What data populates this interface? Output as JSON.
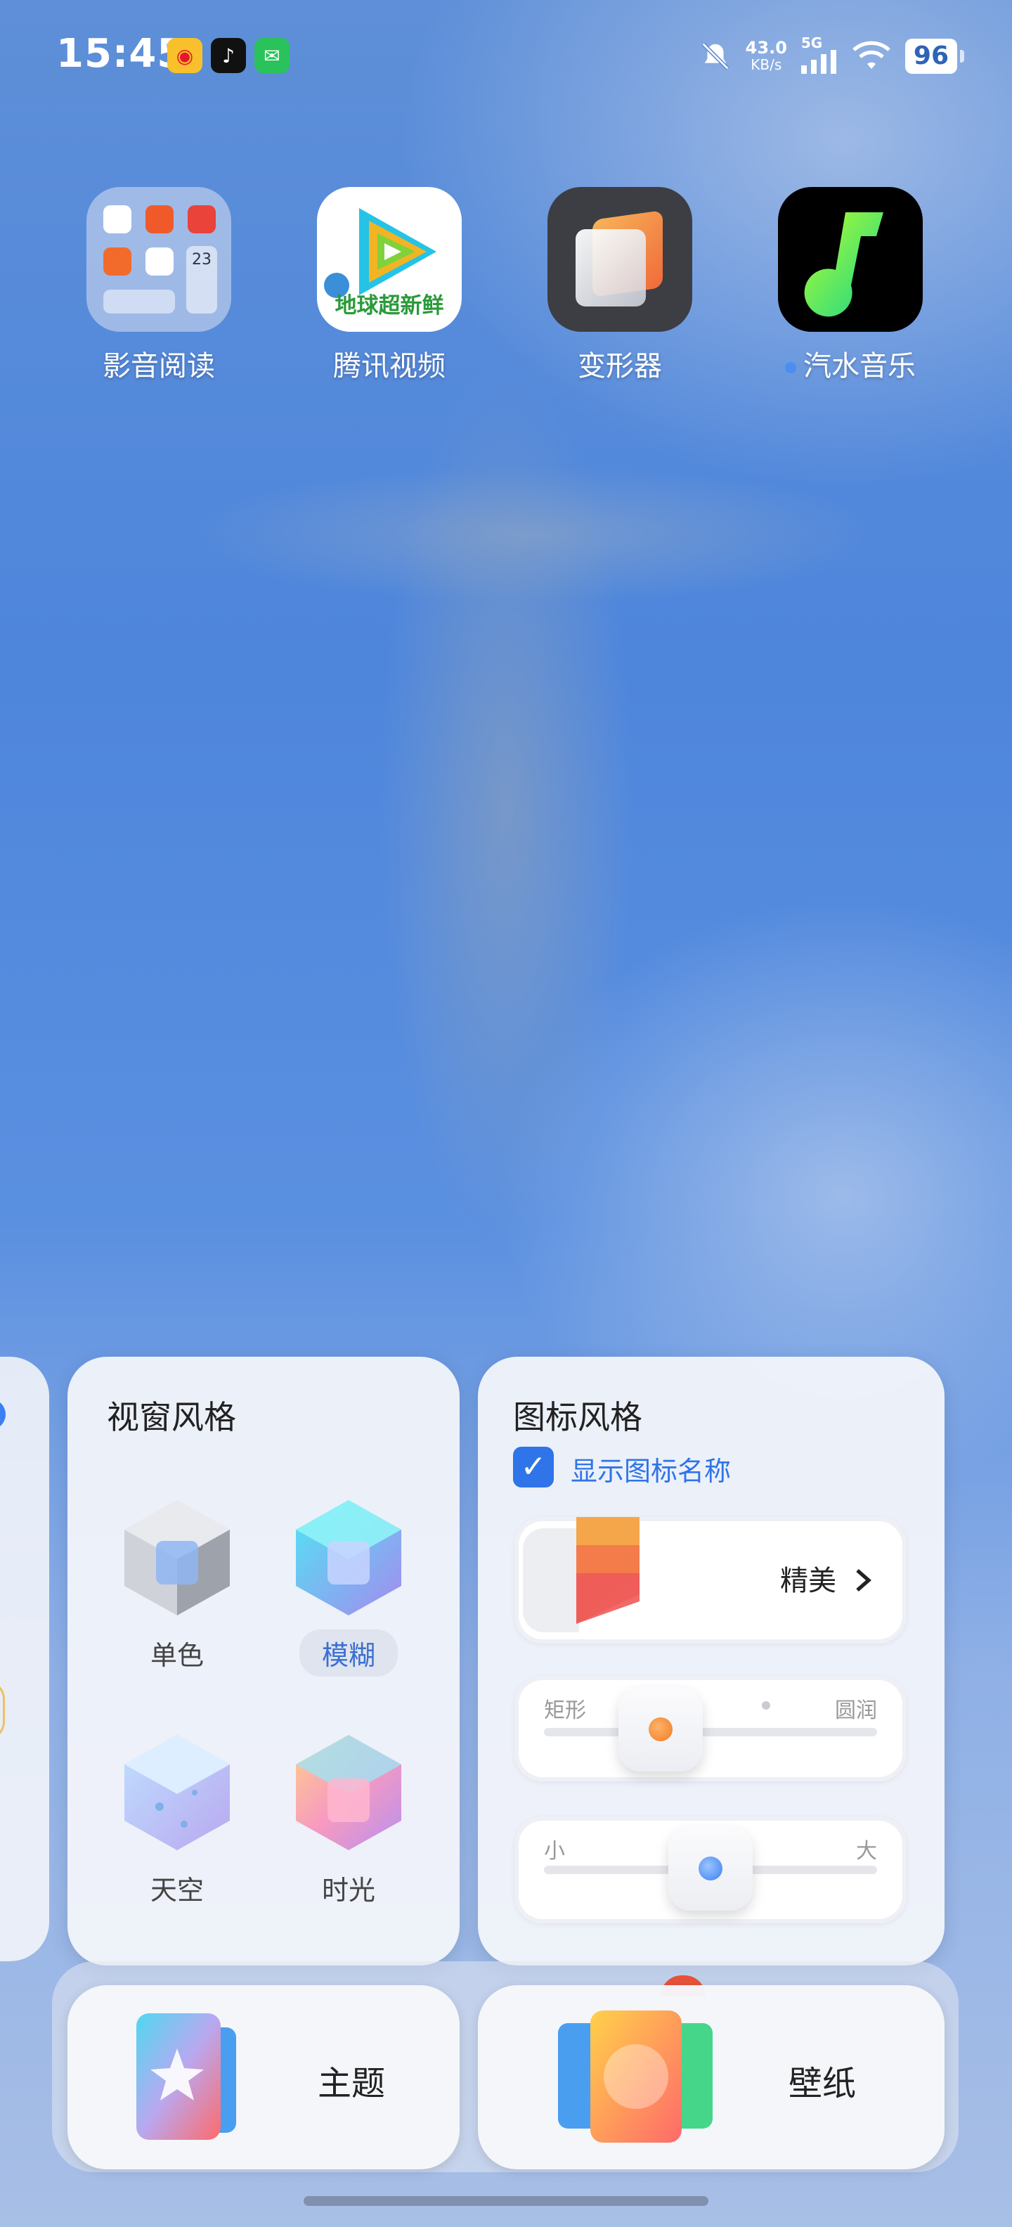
{
  "status_bar": {
    "time": "15:45",
    "network_speed": "43.0",
    "network_unit": "KB/s",
    "signal_type": "5G",
    "battery": "96"
  },
  "apps": [
    {
      "label": "影音阅读",
      "icon": "folder-icon"
    },
    {
      "label": "腾讯视频",
      "icon": "tencent-video-icon",
      "badge_text": "地球超新鲜"
    },
    {
      "label": "变形器",
      "icon": "transformer-icon"
    },
    {
      "label": "汽水音乐",
      "icon": "soda-music-icon",
      "has_new_dot": true
    }
  ],
  "folder_mini": {
    "date": "23"
  },
  "window_style": {
    "title": "视窗风格",
    "options": [
      {
        "label": "单色",
        "selected": false
      },
      {
        "label": "模糊",
        "selected": true
      },
      {
        "label": "天空",
        "selected": false
      },
      {
        "label": "时光",
        "selected": false
      }
    ]
  },
  "icon_style": {
    "title": "图标风格",
    "show_names_label": "显示图标名称",
    "show_names_checked": true,
    "style_name": "精美",
    "shape_slider": {
      "left": "矩形",
      "right": "圆润",
      "value": 0.35
    },
    "size_slider": {
      "left": "小",
      "right": "大",
      "value": 0.5
    }
  },
  "bottom_buttons": {
    "theme_label": "主题",
    "wallpaper_label": "壁纸"
  },
  "colors": {
    "accent": "#2f74e8",
    "orange": "#f08a30"
  }
}
